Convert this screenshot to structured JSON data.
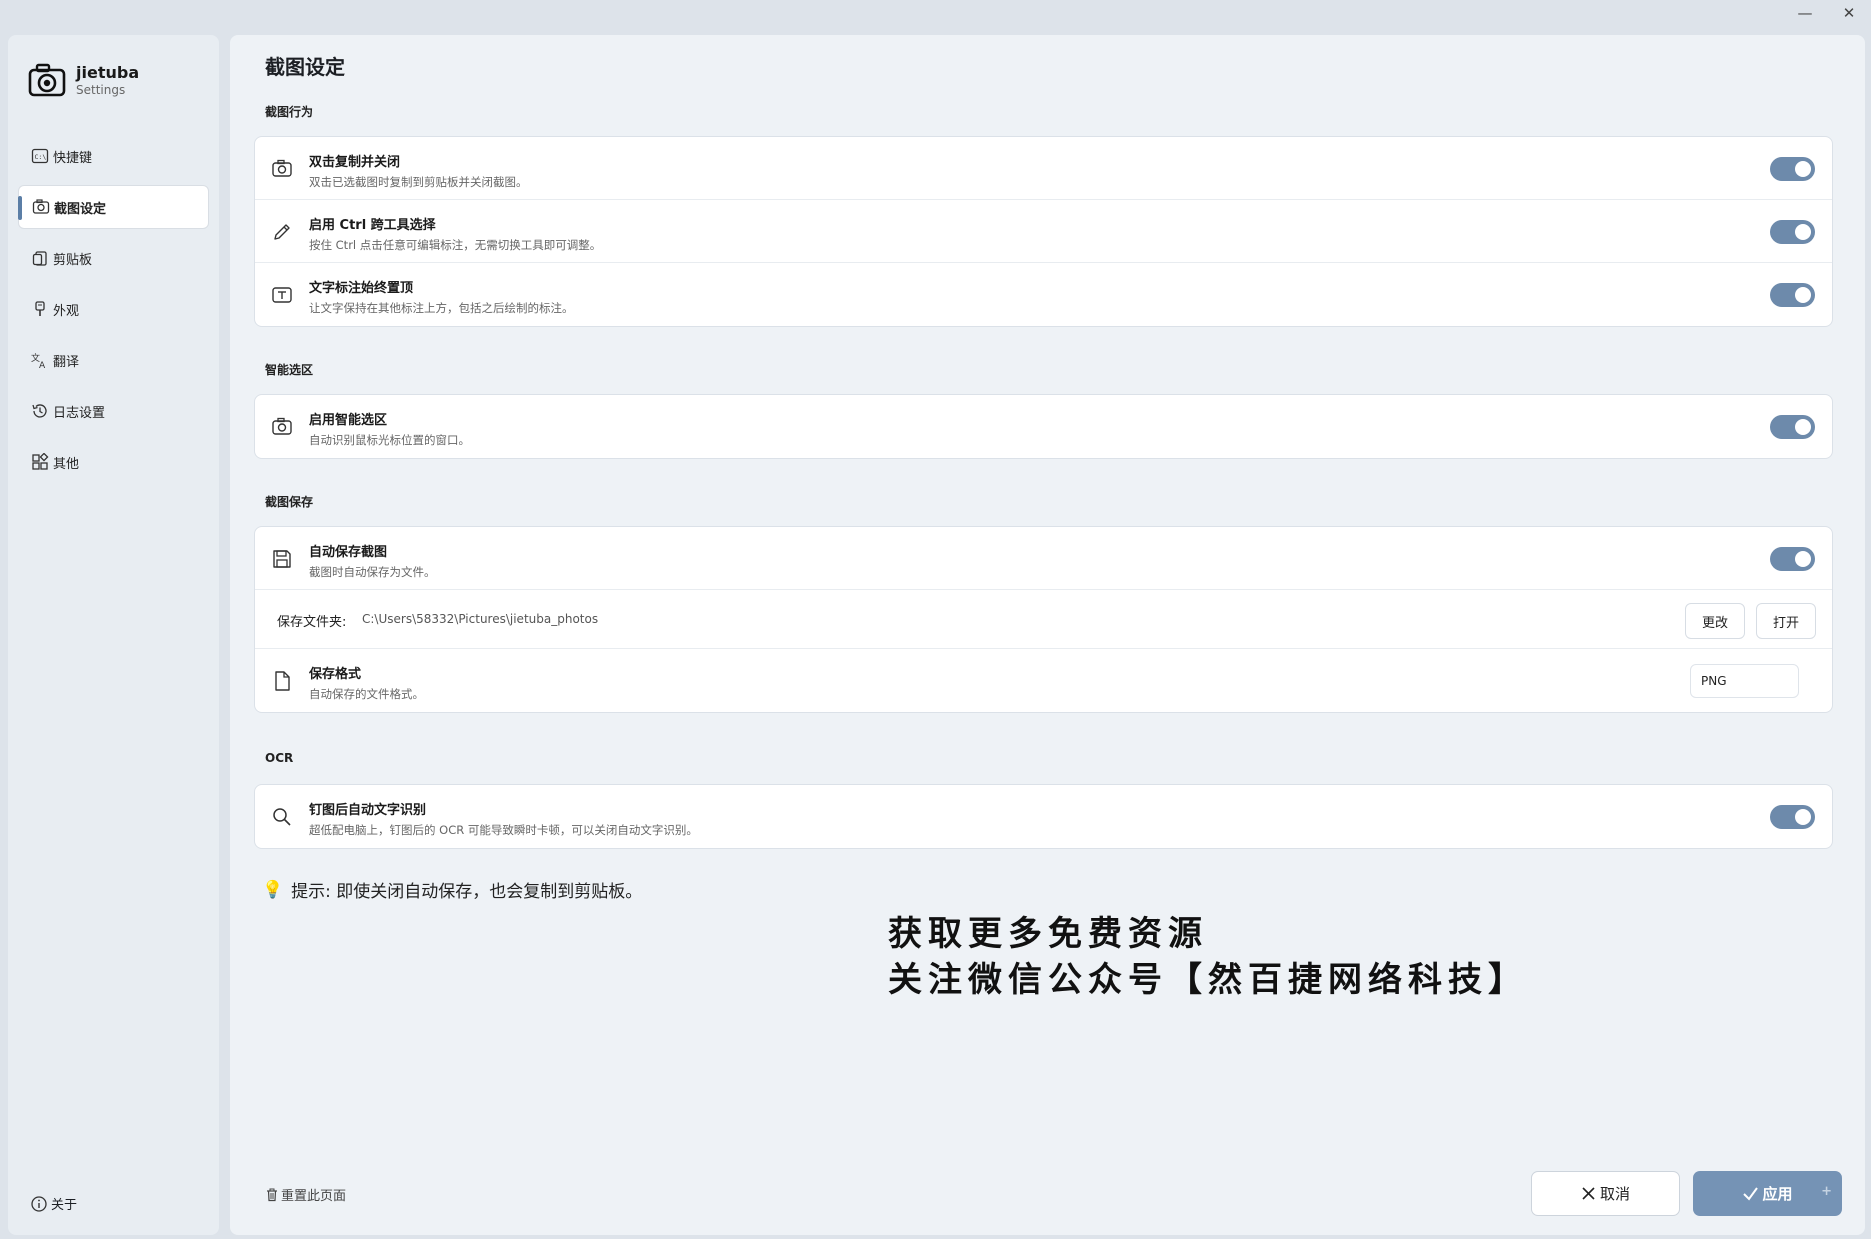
{
  "window": {
    "minimize_glyph": "—",
    "close_glyph": "✕"
  },
  "brand": {
    "name": "jietuba",
    "subtitle": "Settings"
  },
  "nav": {
    "items": [
      {
        "label": "快捷键",
        "icon": "keyboard-icon"
      },
      {
        "label": "截图设定",
        "icon": "camera-icon",
        "active": true
      },
      {
        "label": "剪贴板",
        "icon": "clipboard-icon"
      },
      {
        "label": "外观",
        "icon": "brush-icon"
      },
      {
        "label": "翻译",
        "icon": "translate-icon"
      },
      {
        "label": "日志设置",
        "icon": "history-icon"
      },
      {
        "label": "其他",
        "icon": "apps-icon"
      }
    ],
    "about": "关于"
  },
  "page": {
    "title": "截图设定"
  },
  "sections": {
    "behavior": {
      "label": "截图行为",
      "rows": [
        {
          "title": "双击复制并关闭",
          "desc": "双击已选截图时复制到剪贴板并关闭截图。",
          "icon": "camera-icon",
          "enabled": true
        },
        {
          "title": "启用 Ctrl 跨工具选择",
          "desc": "按住 Ctrl 点击任意可编辑标注，无需切换工具即可调整。",
          "icon": "pencil-icon",
          "enabled": true
        },
        {
          "title": "文字标注始终置顶",
          "desc": "让文字保持在其他标注上方，包括之后绘制的标注。",
          "icon": "text-box-icon",
          "enabled": true
        }
      ]
    },
    "smart": {
      "label": "智能选区",
      "rows": [
        {
          "title": "启用智能选区",
          "desc": "自动识别鼠标光标位置的窗口。",
          "icon": "camera-icon",
          "enabled": true
        }
      ]
    },
    "save": {
      "label": "截图保存",
      "autosave": {
        "title": "自动保存截图",
        "desc": "截图时自动保存为文件。",
        "icon": "save-icon",
        "enabled": true
      },
      "folder": {
        "label": "保存文件夹:",
        "path": "C:\\Users\\58332\\Pictures\\jietuba_photos",
        "change_label": "更改",
        "open_label": "打开"
      },
      "format": {
        "title": "保存格式",
        "desc": "自动保存的文件格式。",
        "icon": "file-icon",
        "value": "PNG"
      }
    },
    "ocr": {
      "label": "OCR",
      "rows": [
        {
          "title": "钉图后自动文字识别",
          "desc": "超低配电脑上，钉图后的 OCR 可能导致瞬时卡顿，可以关闭自动文字识别。",
          "icon": "search-icon",
          "enabled": true
        }
      ]
    }
  },
  "tip": {
    "bulb": "💡",
    "text": "提示: 即使关闭自动保存，也会复制到剪贴板。"
  },
  "watermark": {
    "line1": "获取更多免费资源",
    "line2": "关注微信公众号【然百捷网络科技】"
  },
  "footer": {
    "reset_label": "重置此页面",
    "cancel_label": "取消",
    "apply_label": "应用",
    "apply_caret": "+"
  },
  "colors": {
    "accent": "#6d8aab",
    "apply_bg": "#7593b5",
    "sidebar_bg": "#e8edf2",
    "main_bg": "#eef2f6"
  }
}
